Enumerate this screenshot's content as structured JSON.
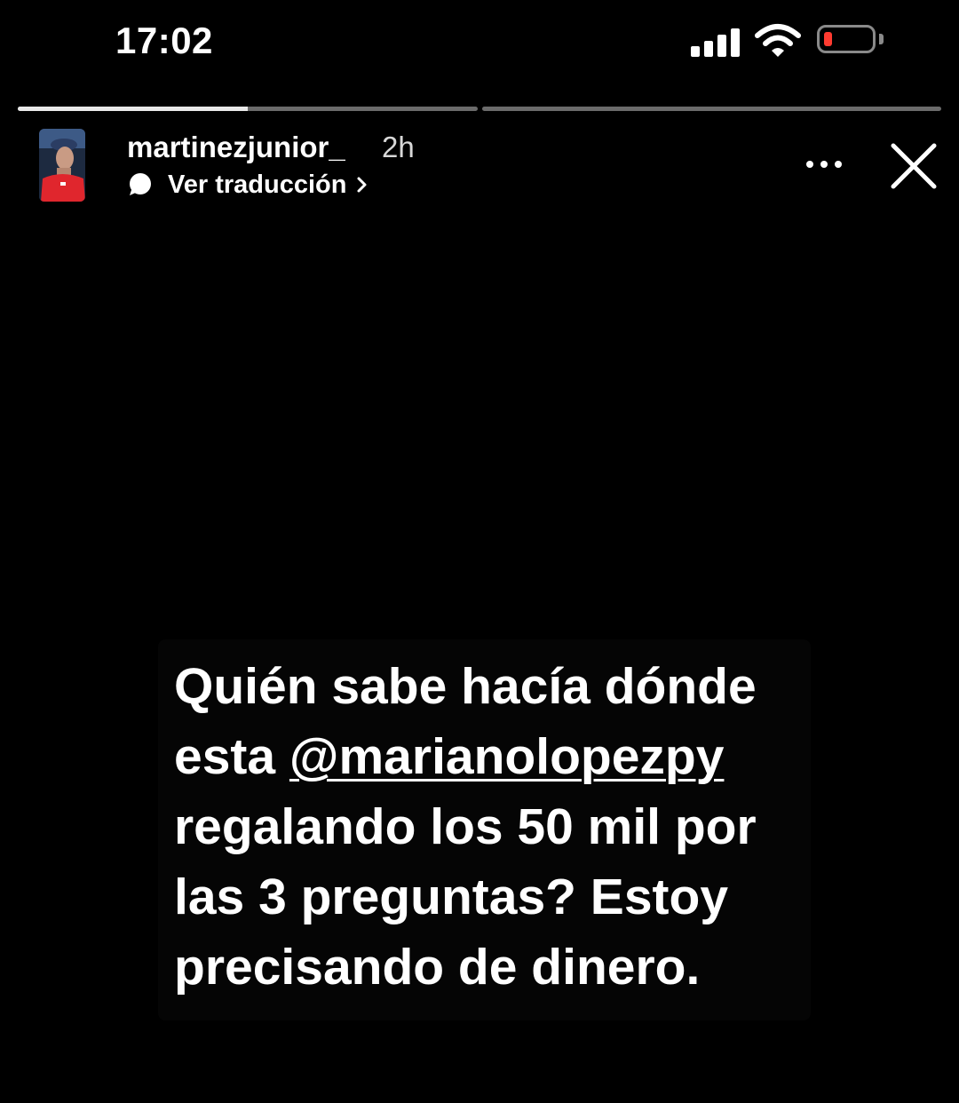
{
  "status_bar": {
    "time": "17:02",
    "battery_level_percent": 8,
    "battery_color": "#ff3b30"
  },
  "story": {
    "segments": [
      {
        "progress_percent": 50
      },
      {
        "progress_percent": 0
      }
    ],
    "username": "martinezjunior_",
    "time_ago": "2h",
    "translate_label": "Ver traducción",
    "caption": {
      "line1": "Quién sabe hacía dónde",
      "line2_prefix": "esta ",
      "line2_mention": "@marianolopezpy",
      "line3": "regalando los 50 mil por",
      "line4": "las 3 preguntas? Estoy",
      "line5": "precisando de dinero."
    }
  },
  "icons": {
    "signal": "cellular-signal-icon",
    "wifi": "wifi-icon",
    "battery": "battery-low-icon",
    "translate": "chat-bubble-icon",
    "more": "more-options-icon",
    "close": "close-icon"
  },
  "colors": {
    "background": "#000000",
    "text": "#ffffff",
    "progress_track": "#6b6b6b",
    "progress_fill": "#e9e9e9"
  }
}
